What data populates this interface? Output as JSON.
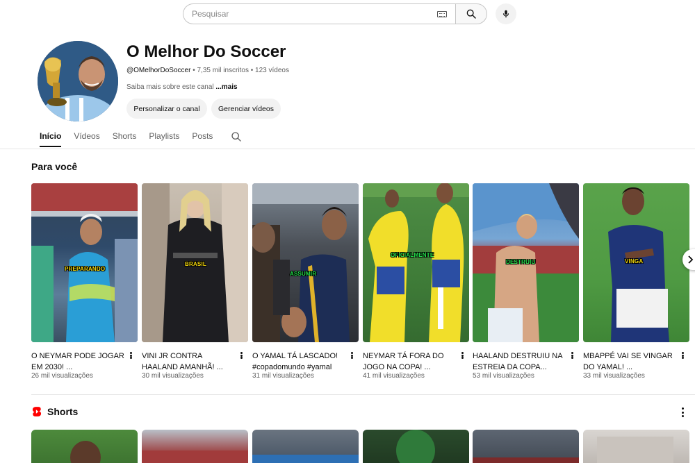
{
  "search": {
    "placeholder": "Pesquisar",
    "keyboard_icon": "keyboard-icon",
    "search_icon": "search-icon",
    "mic_icon": "microphone-icon"
  },
  "channel": {
    "name": "O Melhor Do Soccer",
    "handle": "@OMelhorDoSoccer",
    "subscribers": "7,35 mil inscritos",
    "videos": "123 vídeos",
    "separator": "•",
    "about": "Saiba mais sobre este canal",
    "about_more": "...mais",
    "customize_button": "Personalizar o canal",
    "manage_button": "Gerenciar vídeos"
  },
  "tabs": [
    {
      "label": "Início",
      "active": true
    },
    {
      "label": "Vídeos",
      "active": false
    },
    {
      "label": "Shorts",
      "active": false
    },
    {
      "label": "Playlists",
      "active": false
    },
    {
      "label": "Posts",
      "active": false
    }
  ],
  "for_you": {
    "title": "Para você",
    "videos": [
      {
        "title": "O NEYMAR PODE JOGAR EM 2030! ...",
        "views": "26 mil visualizações",
        "tag": "PREPARANDO",
        "tag_color": "#f5d90a"
      },
      {
        "title": "VINI JR CONTRA HAALAND AMANHÃ! ...",
        "views": "30 mil visualizações",
        "tag": "BRASIL",
        "tag_color": "#f5d90a"
      },
      {
        "title": "O YAMAL TÁ LASCADO! #copadomundo #yamal",
        "views": "31 mil visualizações",
        "tag": "ASSUMIR",
        "tag_color": "#22e04a"
      },
      {
        "title": "NEYMAR TÁ FORA DO JOGO NA COPA! ...",
        "views": "41 mil visualizações",
        "tag": "OFICIALMENTE",
        "tag_color": "#22e04a"
      },
      {
        "title": "HAALAND DESTRUIU NA ESTREIA DA COPA...",
        "views": "53 mil visualizações",
        "tag": "DESTRUIU",
        "tag_color": "#22e04a"
      },
      {
        "title": "MBAPPÉ VAI SE VINGAR DO YAMAL! ...",
        "views": "33 mil visualizações",
        "tag": "VINGA",
        "tag_color": "#f5d90a"
      }
    ]
  },
  "shorts": {
    "title": "Shorts"
  },
  "colors": {
    "accent_red": "#ff0000",
    "text_primary": "#0f0f0f",
    "text_secondary": "#606060"
  }
}
